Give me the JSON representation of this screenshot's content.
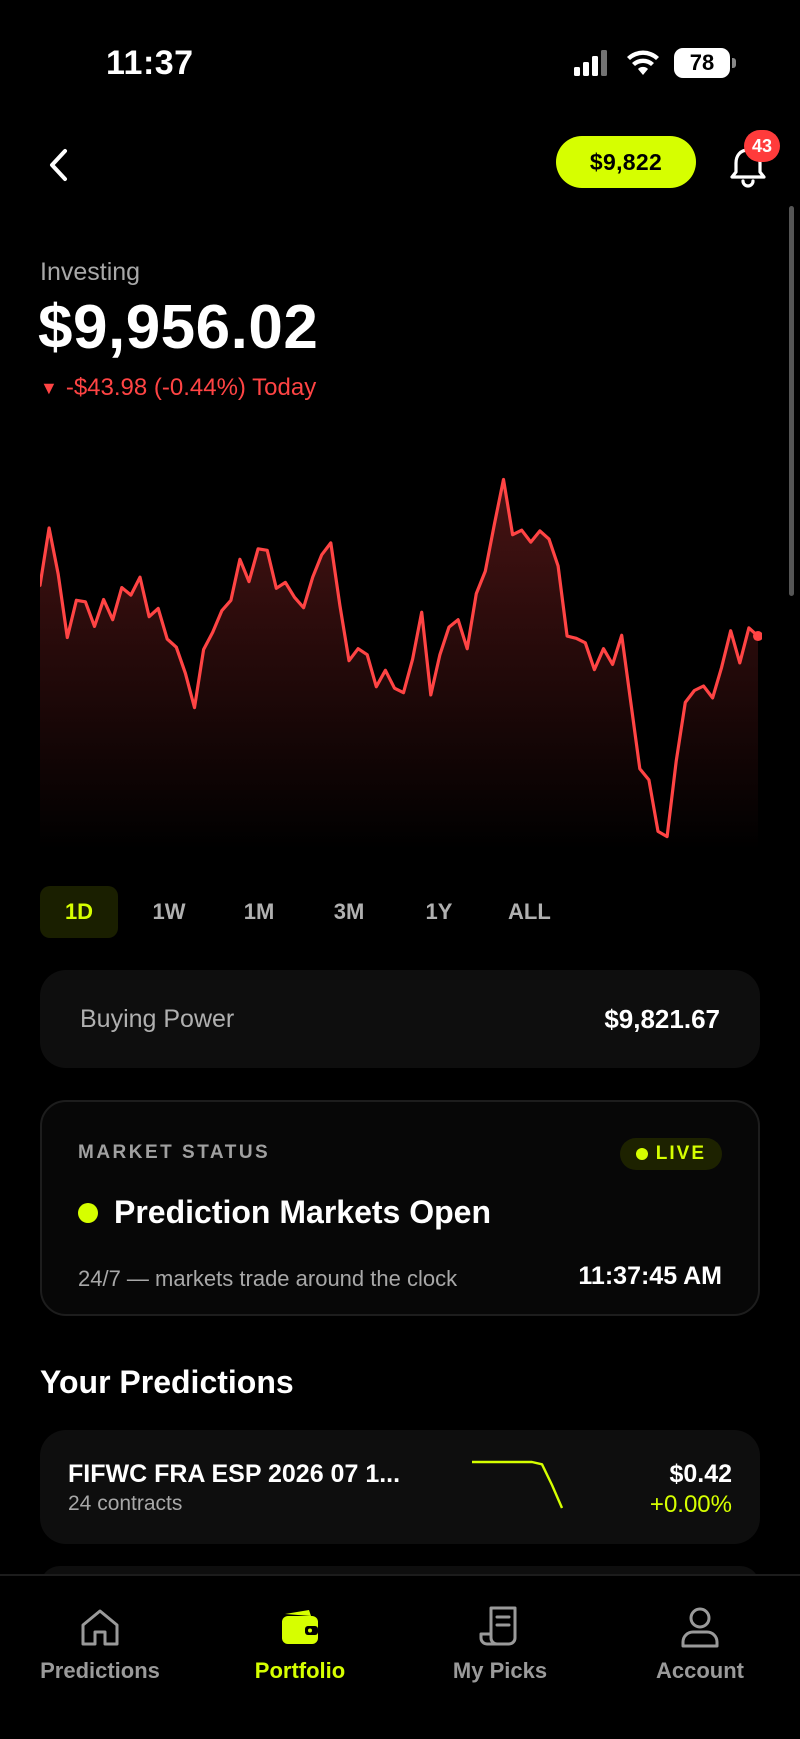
{
  "status_bar": {
    "time": "11:37",
    "battery": "78"
  },
  "header": {
    "balance": "$9,822",
    "notifications": "43"
  },
  "portfolio": {
    "label": "Investing",
    "value": "$9,956.02",
    "change_arrow": "▼",
    "change_text": "-$43.98 (-0.44%) Today"
  },
  "chart_data": {
    "type": "area",
    "values": [
      9960.5,
      9968.2,
      9962.0,
      9953.5,
      9958.5,
      9958.3,
      9955.0,
      9958.6,
      9955.9,
      9960.2,
      9959.2,
      9961.6,
      9956.3,
      9957.4,
      9953.3,
      9952.2,
      9948.7,
      9944.1,
      9951.9,
      9954.2,
      9957.1,
      9958.5,
      9964.0,
      9961.0,
      9965.4,
      9965.2,
      9960.1,
      9960.9,
      9958.9,
      9957.5,
      9961.6,
      9964.6,
      9966.2,
      9957.8,
      9950.4,
      9952.0,
      9951.2,
      9946.9,
      9949.1,
      9946.7,
      9946.1,
      9950.6,
      9956.9,
      9945.8,
      9951.2,
      9954.9,
      9955.9,
      9952.0,
      9959.4,
      9962.4,
      9968.7,
      9974.7,
      9967.3,
      9967.9,
      9966.3,
      9967.8,
      9966.7,
      9963.1,
      9953.7,
      9953.4,
      9952.8,
      9949.2,
      9952.0,
      9949.9,
      9953.8,
      9944.8,
      9935.9,
      9934.4,
      9927.5,
      9926.8,
      9936.9,
      9944.8,
      9946.4,
      9947.0,
      9945.4,
      9949.5,
      9954.4,
      9950.1,
      9954.8,
      9953.7
    ],
    "y_range": [
      9925,
      9980
    ],
    "line_color": "#ff4444",
    "grid": false
  },
  "range_tabs": [
    "1D",
    "1W",
    "1M",
    "3M",
    "1Y",
    "ALL"
  ],
  "buying_power": {
    "label": "Buying Power",
    "value": "$9,821.67"
  },
  "market_status": {
    "title": "MARKET STATUS",
    "badge": "LIVE",
    "headline": "Prediction Markets Open",
    "subtitle": "24/7 — markets trade around the clock",
    "clock": "11:37:45 AM"
  },
  "predictions": {
    "title": "Your Predictions",
    "items": [
      {
        "name": "FIFWC FRA ESP 2026 07 1...",
        "contracts": "24 contracts",
        "price": "$0.42",
        "change": "+0.00%",
        "spark": [
          0.44,
          0.44,
          0.44,
          0.44,
          0.44,
          0.44,
          0.44,
          0.439,
          0.43,
          0.42
        ]
      }
    ]
  },
  "nav": {
    "items": [
      {
        "label": "Predictions",
        "icon": "home-icon"
      },
      {
        "label": "Portfolio",
        "icon": "wallet-icon"
      },
      {
        "label": "My Picks",
        "icon": "receipt-icon"
      },
      {
        "label": "Account",
        "icon": "user-icon"
      }
    ],
    "active": "Portfolio"
  },
  "colors": {
    "accent": "#d6ff00",
    "negative": "#ff4444",
    "badge": "#ff3b3b"
  }
}
